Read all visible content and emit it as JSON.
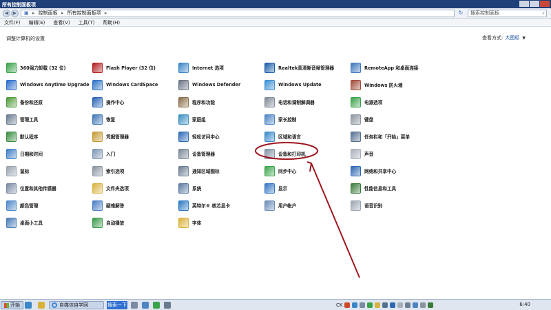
{
  "window": {
    "title": "所有控制面板项"
  },
  "addressbar": {
    "crumbs": [
      "控制面板",
      "所有控制面板项"
    ],
    "search_placeholder": "搜索控制面板"
  },
  "menu": [
    "文件(F)",
    "编辑(E)",
    "查看(V)",
    "工具(T)",
    "帮助(H)"
  ],
  "content": {
    "heading": "调整计算机的设置",
    "view_label": "查看方式:",
    "view_value": "大图标"
  },
  "columns": [
    [
      {
        "label": "360强力卸载 (32 位)",
        "icon": "uninstall-icon",
        "color": "#3aa24a"
      },
      {
        "label": "Windows Anytime Upgrade",
        "icon": "windows-upgrade-icon",
        "color": "#2c6bc9"
      },
      {
        "label": "备份和还原",
        "icon": "backup-icon",
        "color": "#4f9a3a"
      },
      {
        "label": "管理工具",
        "icon": "admin-tools-icon",
        "color": "#6a7b8f"
      },
      {
        "label": "默认程序",
        "icon": "default-programs-icon",
        "color": "#3b8d3f"
      },
      {
        "label": "日期和时间",
        "icon": "datetime-icon",
        "color": "#3f7fc6"
      },
      {
        "label": "鼠标",
        "icon": "mouse-icon",
        "color": "#9aa4b0"
      },
      {
        "label": "位置和其他传感器",
        "icon": "sensors-icon",
        "color": "#7a8aa3"
      },
      {
        "label": "颜色管理",
        "icon": "color-mgmt-icon",
        "color": "#4e87c8"
      },
      {
        "label": "桌面小工具",
        "icon": "gadgets-icon",
        "color": "#4a7db8"
      }
    ],
    [
      {
        "label": "Flash Player (32 位)",
        "icon": "flash-icon",
        "color": "#b31f1f"
      },
      {
        "label": "Windows CardSpace",
        "icon": "cardspace-icon",
        "color": "#2e73c2"
      },
      {
        "label": "操作中心",
        "icon": "action-center-icon",
        "color": "#2b63b5"
      },
      {
        "label": "恢复",
        "icon": "recovery-icon",
        "color": "#4277b5"
      },
      {
        "label": "凭据管理器",
        "icon": "credentials-icon",
        "color": "#c69a34"
      },
      {
        "label": "入门",
        "icon": "getting-started-icon",
        "color": "#7e96b5"
      },
      {
        "label": "索引选项",
        "icon": "indexing-icon",
        "color": "#8b95a1"
      },
      {
        "label": "文件夹选项",
        "icon": "folder-options-icon",
        "color": "#d8b341"
      },
      {
        "label": "疑难解答",
        "icon": "troubleshoot-icon",
        "color": "#4a7dc4"
      },
      {
        "label": "自动播放",
        "icon": "autoplay-icon",
        "color": "#3a9a4a"
      }
    ],
    [
      {
        "label": "Internet 选项",
        "icon": "internet-options-icon",
        "color": "#3a86c8"
      },
      {
        "label": "Windows Defender",
        "icon": "defender-icon",
        "color": "#6b7686"
      },
      {
        "label": "程序和功能",
        "icon": "programs-icon",
        "color": "#8a6f4a"
      },
      {
        "label": "家庭组",
        "icon": "homegroup-icon",
        "color": "#3b8fc1"
      },
      {
        "label": "轻松访问中心",
        "icon": "ease-access-icon",
        "color": "#2f6ab8"
      },
      {
        "label": "设备管理器",
        "icon": "device-manager-icon",
        "color": "#7b8796"
      },
      {
        "label": "通知区域图标",
        "icon": "notification-icon",
        "color": "#6e7f93"
      },
      {
        "label": "系统",
        "icon": "system-icon",
        "color": "#5b7ba3"
      },
      {
        "label": "英特尔® 核芯显卡",
        "icon": "intel-graphics-icon",
        "color": "#2a78c3"
      },
      {
        "label": "字体",
        "icon": "fonts-icon",
        "color": "#d9b23d"
      }
    ],
    [
      {
        "label": "Realtek高清晰音频管理器",
        "icon": "realtek-icon",
        "color": "#1d5ea8"
      },
      {
        "label": "Windows Update",
        "icon": "windows-update-icon",
        "color": "#3a8ed3"
      },
      {
        "label": "电话和调制解调器",
        "icon": "phone-modem-icon",
        "color": "#7f8a97"
      },
      {
        "label": "家长控制",
        "icon": "parental-icon",
        "color": "#4d84c4"
      },
      {
        "label": "区域和语言",
        "icon": "region-icon",
        "color": "#3b89c8"
      },
      {
        "label": "设备和打印机",
        "icon": "printer-icon",
        "color": "#8393a6"
      },
      {
        "label": "同步中心",
        "icon": "sync-icon",
        "color": "#3aa64b"
      },
      {
        "label": "显示",
        "icon": "display-icon",
        "color": "#3677c2"
      },
      {
        "label": "用户帐户",
        "icon": "user-accounts-icon",
        "color": "#6a8db8"
      }
    ],
    [
      {
        "label": "RemoteApp 和桌面连接",
        "icon": "remoteapp-icon",
        "color": "#3f78bd"
      },
      {
        "label": "Windows 防火墙",
        "icon": "firewall-icon",
        "color": "#a34a3a"
      },
      {
        "label": "电源选项",
        "icon": "power-icon",
        "color": "#3aa24a"
      },
      {
        "label": "键盘",
        "icon": "keyboard-icon",
        "color": "#8b949f"
      },
      {
        "label": "任务栏和「开始」菜单",
        "icon": "taskbar-icon",
        "color": "#55708f"
      },
      {
        "label": "声音",
        "icon": "sound-icon",
        "color": "#a7b0ba"
      },
      {
        "label": "网络和共享中心",
        "icon": "network-icon",
        "color": "#2f67b3"
      },
      {
        "label": "性能信息和工具",
        "icon": "performance-icon",
        "color": "#3a7a3a"
      },
      {
        "label": "语音识别",
        "icon": "speech-icon",
        "color": "#9aa5b1"
      }
    ]
  ],
  "annotation": {
    "color": "#a0161c"
  },
  "taskbar": {
    "start_label": "开始",
    "task_label": "自媒体自学网",
    "search_button": "搜索一下",
    "tray_labels": [
      "CK"
    ],
    "clock": "6:40"
  }
}
